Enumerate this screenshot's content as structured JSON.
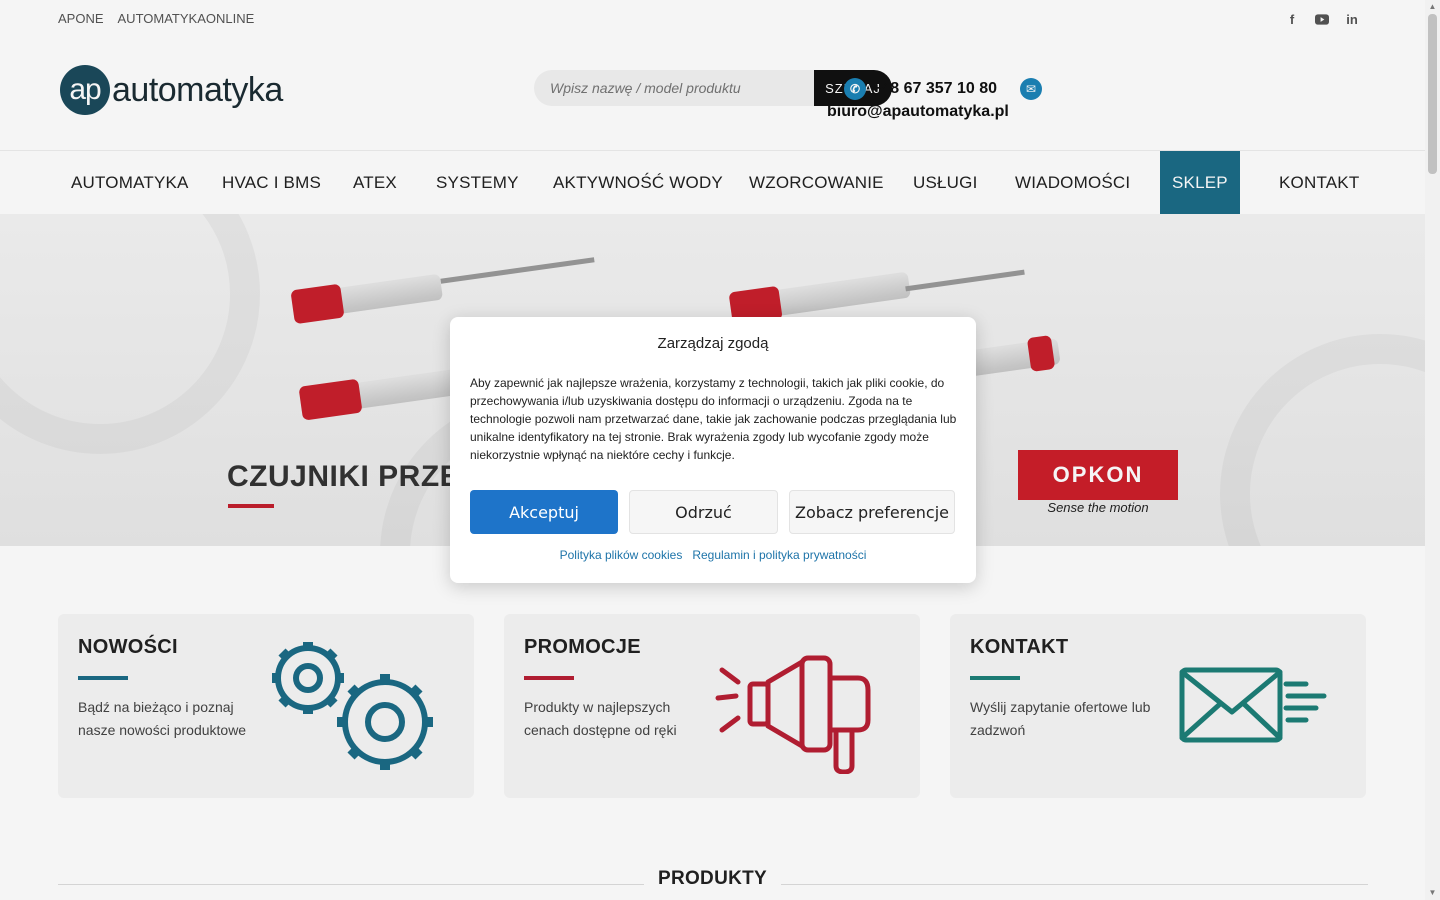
{
  "topbar": {
    "links": [
      "APONE",
      "AUTOMATYKAONLINE"
    ]
  },
  "logo": {
    "mark": "ap",
    "word": "automatyka"
  },
  "search": {
    "placeholder": "Wpisz nazwę / model produktu",
    "button": "SZUKAJ"
  },
  "contact": {
    "phone": "+48 67 357 10 80",
    "email": "biuro@apautomatyka.pl"
  },
  "nav": [
    "AUTOMATYKA",
    "HVAC I BMS",
    "ATEX",
    "SYSTEMY",
    "AKTYWNOŚĆ WODY",
    "WZORCOWANIE",
    "USŁUGI",
    "WIADOMOŚCI",
    "SKLEP",
    "KONTAKT"
  ],
  "hero": {
    "title": "CZUJNIKI PRZEM",
    "brand": "OPKON",
    "brand_tagline": "Sense the motion"
  },
  "cards": [
    {
      "title": "NOWOŚCI",
      "desc": "Bądź na bieżąco i poznaj nasze nowości produktowe",
      "color": "#1c6c87"
    },
    {
      "title": "PROMOCJE",
      "desc": "Produkty w najlepszych cenach dostępne od ręki",
      "color": "#b81f33"
    },
    {
      "title": "KONTAKT",
      "desc": "Wyślij zapytanie ofertowe lub zadzwoń",
      "color": "#1e7f78"
    }
  ],
  "products_heading": "PRODUKTY",
  "consent": {
    "title": "Zarządzaj zgodą",
    "text": "Aby zapewnić jak najlepsze wrażenia, korzystamy z technologii, takich jak pliki cookie, do przechowywania i/lub uzyskiwania dostępu do informacji o urządzeniu. Zgoda na te technologie pozwoli nam przetwarzać dane, takie jak zachowanie podczas przeglądania lub unikalne identyfikatory na tej stronie. Brak wyrażenia zgody lub wycofanie zgody może niekorzystnie wpłynąć na niektóre cechy i funkcje.",
    "accept": "Akceptuj",
    "deny": "Odrzuć",
    "preferences": "Zobacz preferencje",
    "links": [
      "Polityka plików cookies",
      "Regulamin i polityka prywatności"
    ]
  },
  "colors": {
    "accent": "#1c6c87",
    "accept": "#1e74c9",
    "red": "#c21f2d"
  }
}
